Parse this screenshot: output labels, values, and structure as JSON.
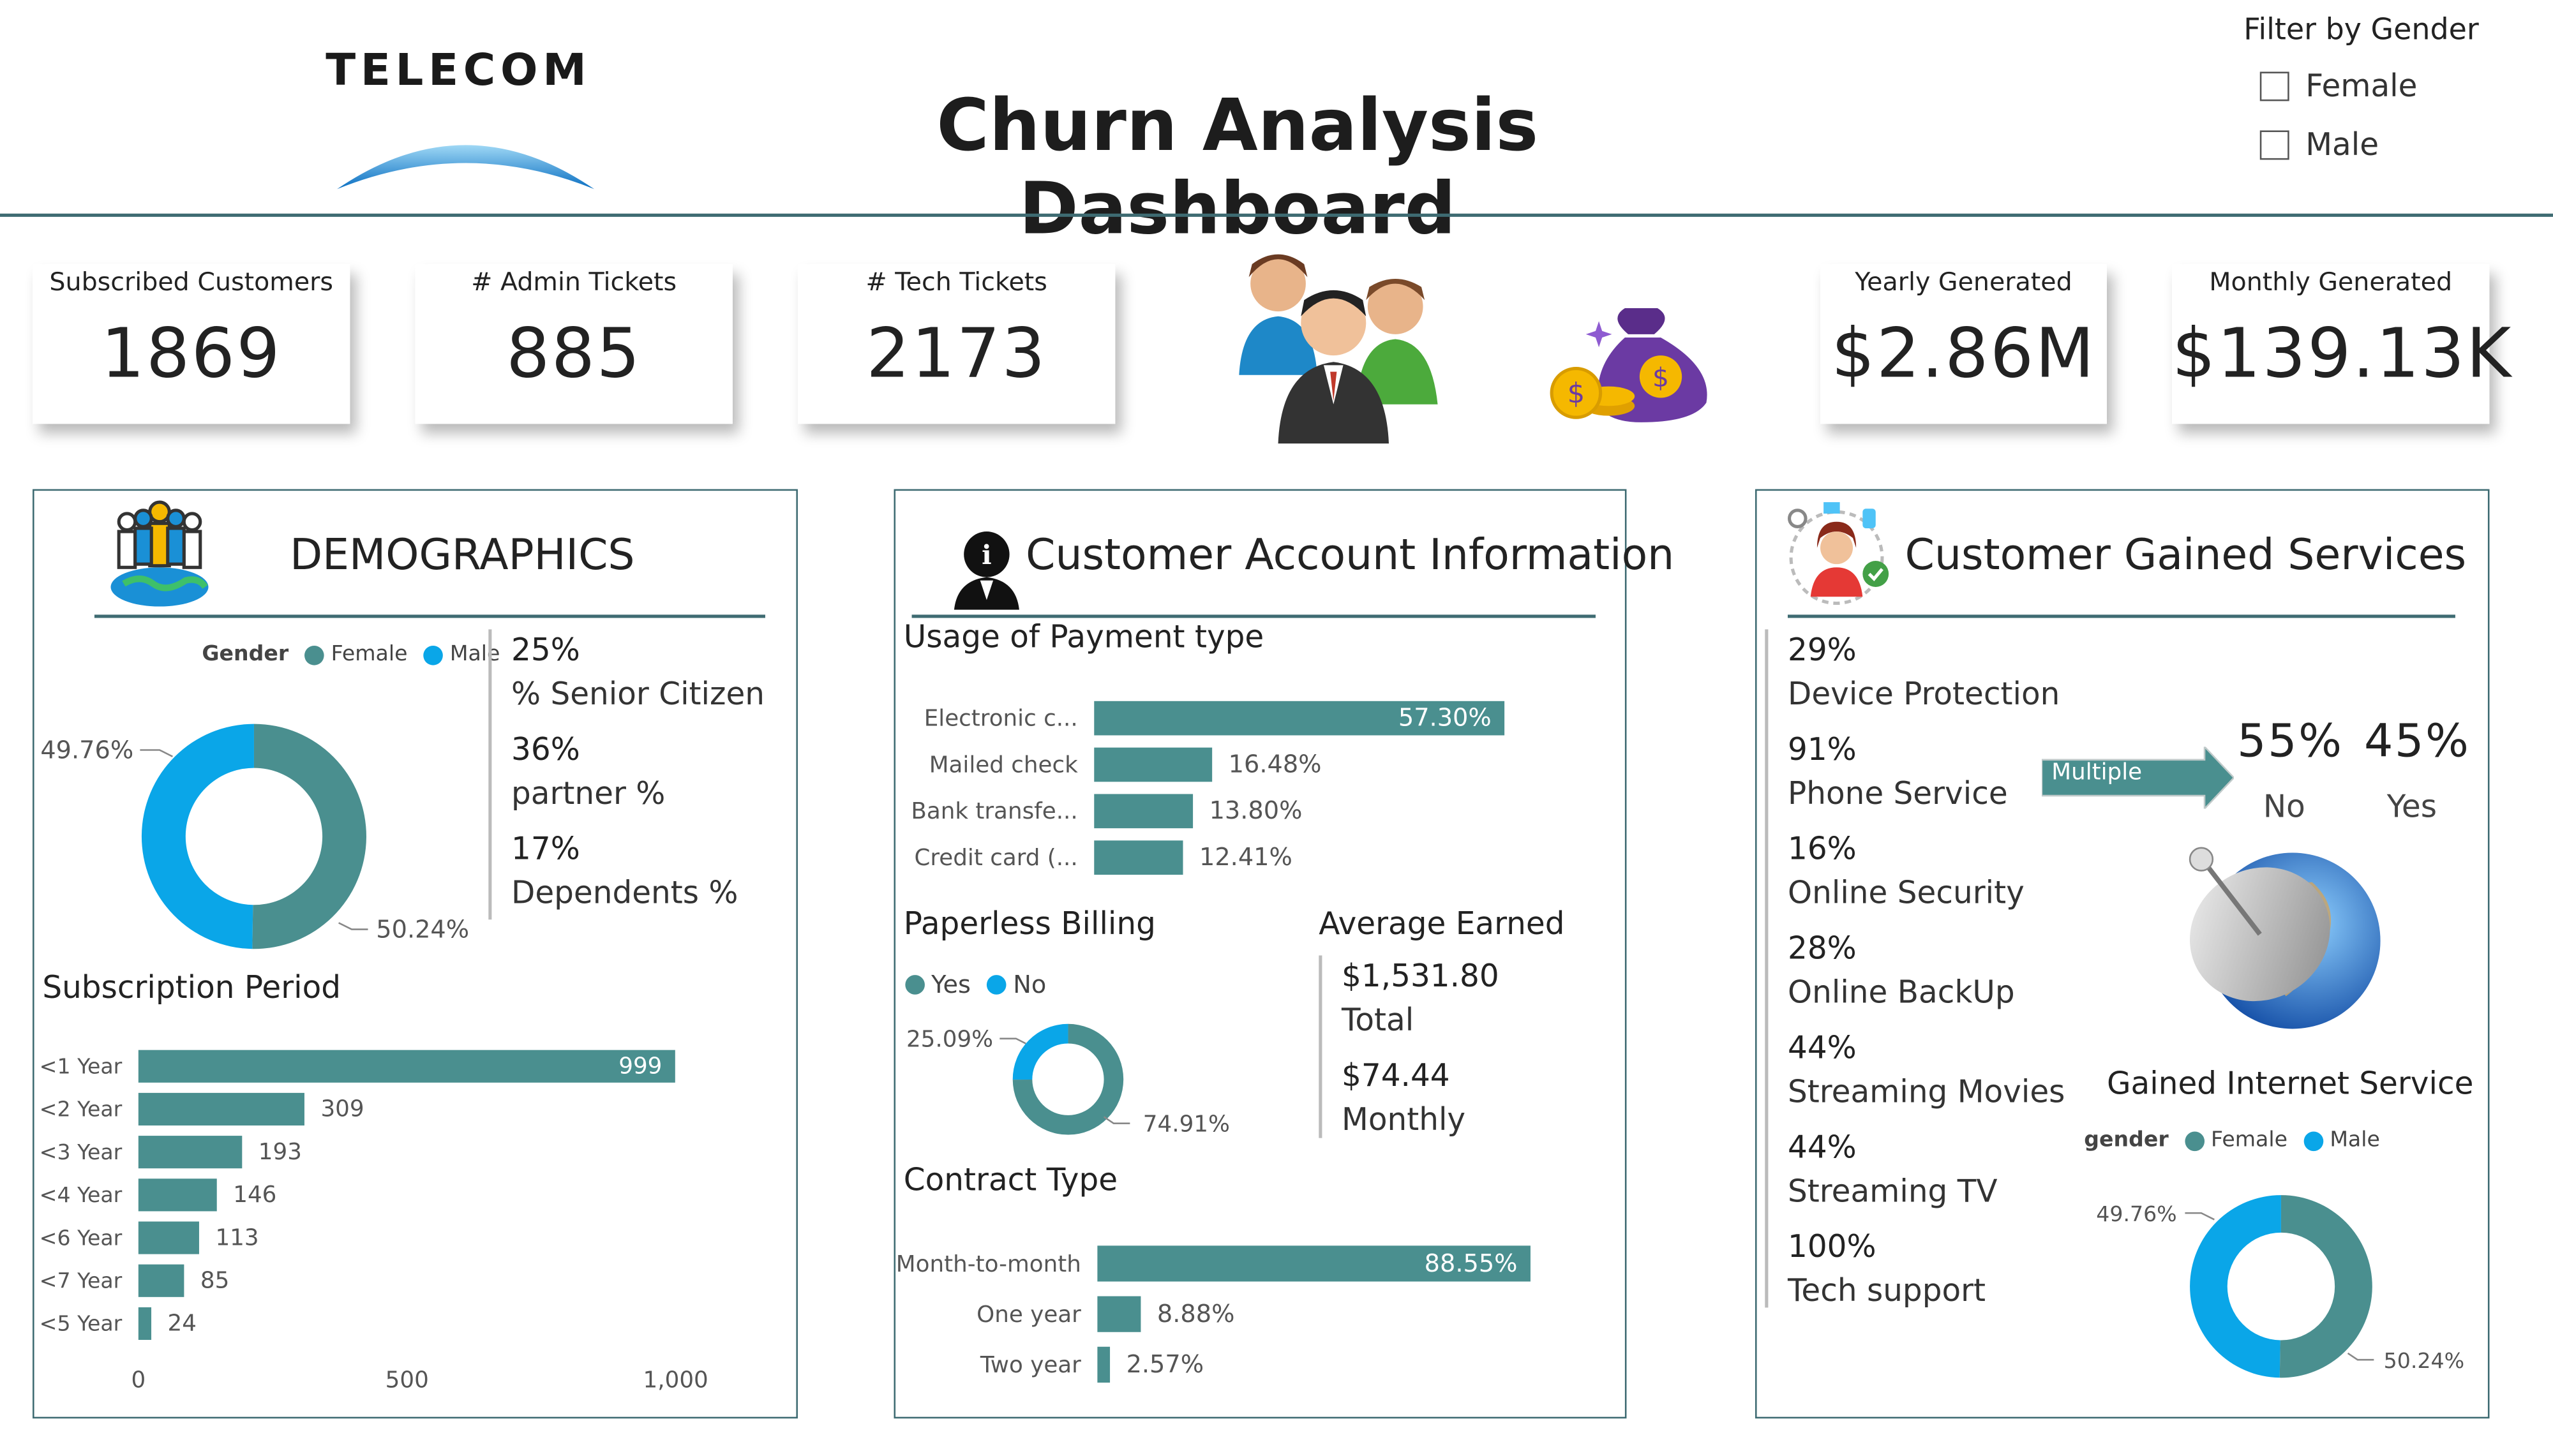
{
  "header": {
    "logo": "TELECOM",
    "title": "Churn Analysis Dashboard",
    "filter_title": "Filter by Gender",
    "filter_options": [
      "Female",
      "Male"
    ]
  },
  "kpis": [
    {
      "label": "Subscribed Customers",
      "value": "1869"
    },
    {
      "label": "# Admin Tickets",
      "value": "885"
    },
    {
      "label": "# Tech Tickets",
      "value": "2173"
    },
    {
      "label": "Yearly Generated",
      "value": "$2.86M"
    },
    {
      "label": "Monthly Generated",
      "value": "$139.13K"
    }
  ],
  "colors": {
    "teal": "#4a8f8f",
    "blue": "#0aa6e8",
    "rule": "#3e6b72"
  },
  "icons": [
    "people-group-icon",
    "money-bag-coins-icon",
    "globe-people-icon",
    "info-user-icon",
    "support-agent-icon",
    "satellite-globe-icon"
  ],
  "demographics": {
    "title": "DEMOGRAPHICS",
    "legend_title": "Gender",
    "stats": [
      {
        "pct": "25%",
        "label": "% Senior Citizen"
      },
      {
        "pct": "36%",
        "label": "partner %"
      },
      {
        "pct": "17%",
        "label": "Dependents %"
      }
    ],
    "subscription_title": "Subscription Period"
  },
  "account": {
    "title": "Customer Account Information",
    "payment_title": "Usage of Payment type",
    "paperless_title": "Paperless Billing",
    "avg_title": "Average Earned",
    "avg": [
      {
        "value": "$1,531.80",
        "label": "Total"
      },
      {
        "value": "$74.44",
        "label": "Monthly"
      }
    ],
    "contract_title": "Contract Type"
  },
  "services": {
    "title": "Customer Gained Services",
    "items": [
      {
        "pct": "29%",
        "label": "Device Protection"
      },
      {
        "pct": "91%",
        "label": "Phone Service"
      },
      {
        "pct": "16%",
        "label": "Online Security"
      },
      {
        "pct": "28%",
        "label": "Online BackUp"
      },
      {
        "pct": "44%",
        "label": "Streaming Movies"
      },
      {
        "pct": "44%",
        "label": "Streaming TV"
      },
      {
        "pct": "100%",
        "label": "Tech support"
      }
    ],
    "multiple_label": "Multiple",
    "multiple": [
      {
        "pct": "55%",
        "label": "No"
      },
      {
        "pct": "45%",
        "label": "Yes"
      }
    ],
    "internet_title": "Gained Internet Service",
    "internet_legend_title": "gender"
  },
  "chart_data": [
    {
      "id": "gender-donut",
      "type": "pie",
      "legend": [
        "Female",
        "Male"
      ],
      "values": [
        50.24,
        49.76
      ],
      "labels": [
        "50.24%",
        "49.76%"
      ]
    },
    {
      "id": "subscription-bar",
      "type": "bar",
      "orientation": "horizontal",
      "categories": [
        "<1 Year",
        "<2 Year",
        "<3 Year",
        "<4 Year",
        "<6 Year",
        "<7 Year",
        "<5 Year"
      ],
      "values": [
        999,
        309,
        193,
        146,
        113,
        85,
        24
      ],
      "labels": [
        "999",
        "309",
        "193",
        "146",
        "113",
        "85",
        "24"
      ],
      "xticks": [
        "0",
        "500",
        "1,000"
      ],
      "xlim": [
        0,
        1000
      ]
    },
    {
      "id": "payment-bar",
      "type": "bar",
      "orientation": "horizontal",
      "categories": [
        "Electronic c...",
        "Mailed check",
        "Bank transfe...",
        "Credit card (..."
      ],
      "values": [
        57.3,
        16.48,
        13.8,
        12.41
      ],
      "labels": [
        "57.30%",
        "16.48%",
        "13.80%",
        "12.41%"
      ],
      "xlim": [
        0,
        57.3
      ]
    },
    {
      "id": "paperless-donut",
      "type": "pie",
      "legend": [
        "Yes",
        "No"
      ],
      "values": [
        74.91,
        25.09
      ],
      "labels": [
        "74.91%",
        "25.09%"
      ]
    },
    {
      "id": "contract-bar",
      "type": "bar",
      "orientation": "horizontal",
      "categories": [
        "Month-to-month",
        "One year",
        "Two year"
      ],
      "values": [
        88.55,
        8.88,
        2.57
      ],
      "labels": [
        "88.55%",
        "8.88%",
        "2.57%"
      ],
      "xlim": [
        0,
        88.55
      ]
    },
    {
      "id": "internet-donut",
      "type": "pie",
      "legend": [
        "Female",
        "Male"
      ],
      "values": [
        50.24,
        49.76
      ],
      "labels": [
        "50.24%",
        "49.76%"
      ]
    }
  ]
}
